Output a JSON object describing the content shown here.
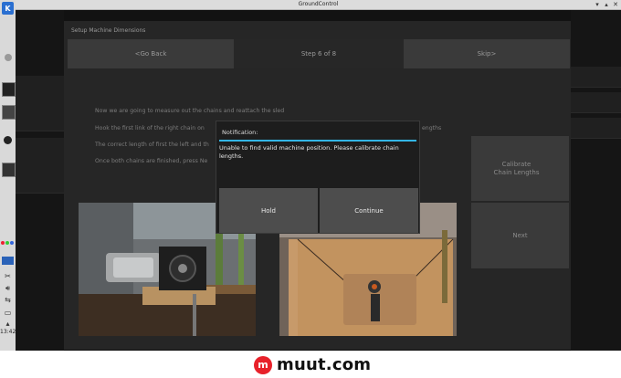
{
  "window": {
    "title": "GroundControl"
  },
  "taskbar": {
    "clock": "13:42"
  },
  "panel": {
    "title": "Setup Machine Dimensions",
    "nav": {
      "back": "<Go Back",
      "step": "Step 6 of 8",
      "skip": "Skip>"
    }
  },
  "instructions": [
    "Now we are going to measure out the chains and reattach the sled",
    "Hook the first link of the right chain on",
    "The correct length of first the left and th",
    "Once both chains are finished, press Ne"
  ],
  "instruction_tail": "engths",
  "side_buttons": {
    "calibrate": "Calibrate\nChain Lengths",
    "next": "Next"
  },
  "dialog": {
    "title": "Notification:",
    "message": "Unable to find valid machine position. Please calibrate chain lengths.",
    "hold": "Hold",
    "continue": "Continue"
  },
  "footer": {
    "brand": "muut.com",
    "mark": "m"
  },
  "colors": {
    "accent": "#33b5e5",
    "brand_red": "#e8212a"
  }
}
